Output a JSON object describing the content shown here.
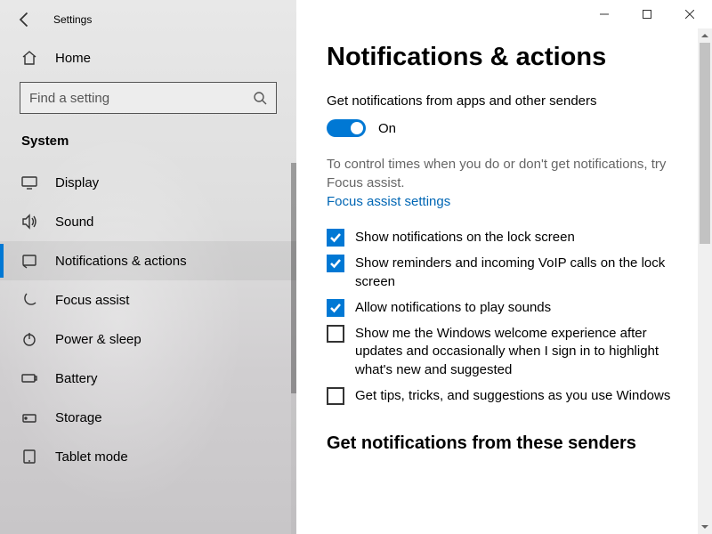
{
  "app": {
    "title": "Settings"
  },
  "sidebar": {
    "home": "Home",
    "search_placeholder": "Find a setting",
    "section": "System",
    "items": [
      {
        "label": "Display",
        "icon": "display"
      },
      {
        "label": "Sound",
        "icon": "sound"
      },
      {
        "label": "Notifications & actions",
        "icon": "notifications",
        "active": true
      },
      {
        "label": "Focus assist",
        "icon": "focus"
      },
      {
        "label": "Power & sleep",
        "icon": "power"
      },
      {
        "label": "Battery",
        "icon": "battery"
      },
      {
        "label": "Storage",
        "icon": "storage"
      },
      {
        "label": "Tablet mode",
        "icon": "tablet"
      }
    ]
  },
  "main": {
    "title": "Notifications & actions",
    "toggle_label": "Get notifications from apps and other senders",
    "toggle_state": "On",
    "help_text": "To control times when you do or don't get notifications, try Focus assist.",
    "link": "Focus assist settings",
    "checks": [
      {
        "label": "Show notifications on the lock screen",
        "checked": true
      },
      {
        "label": "Show reminders and incoming VoIP calls on the lock screen",
        "checked": true
      },
      {
        "label": "Allow notifications to play sounds",
        "checked": true
      },
      {
        "label": "Show me the Windows welcome experience after updates and occasionally when I sign in to highlight what's new and suggested",
        "checked": false
      },
      {
        "label": "Get tips, tricks, and suggestions as you use Windows",
        "checked": false
      }
    ],
    "sub_heading": "Get notifications from these senders"
  }
}
